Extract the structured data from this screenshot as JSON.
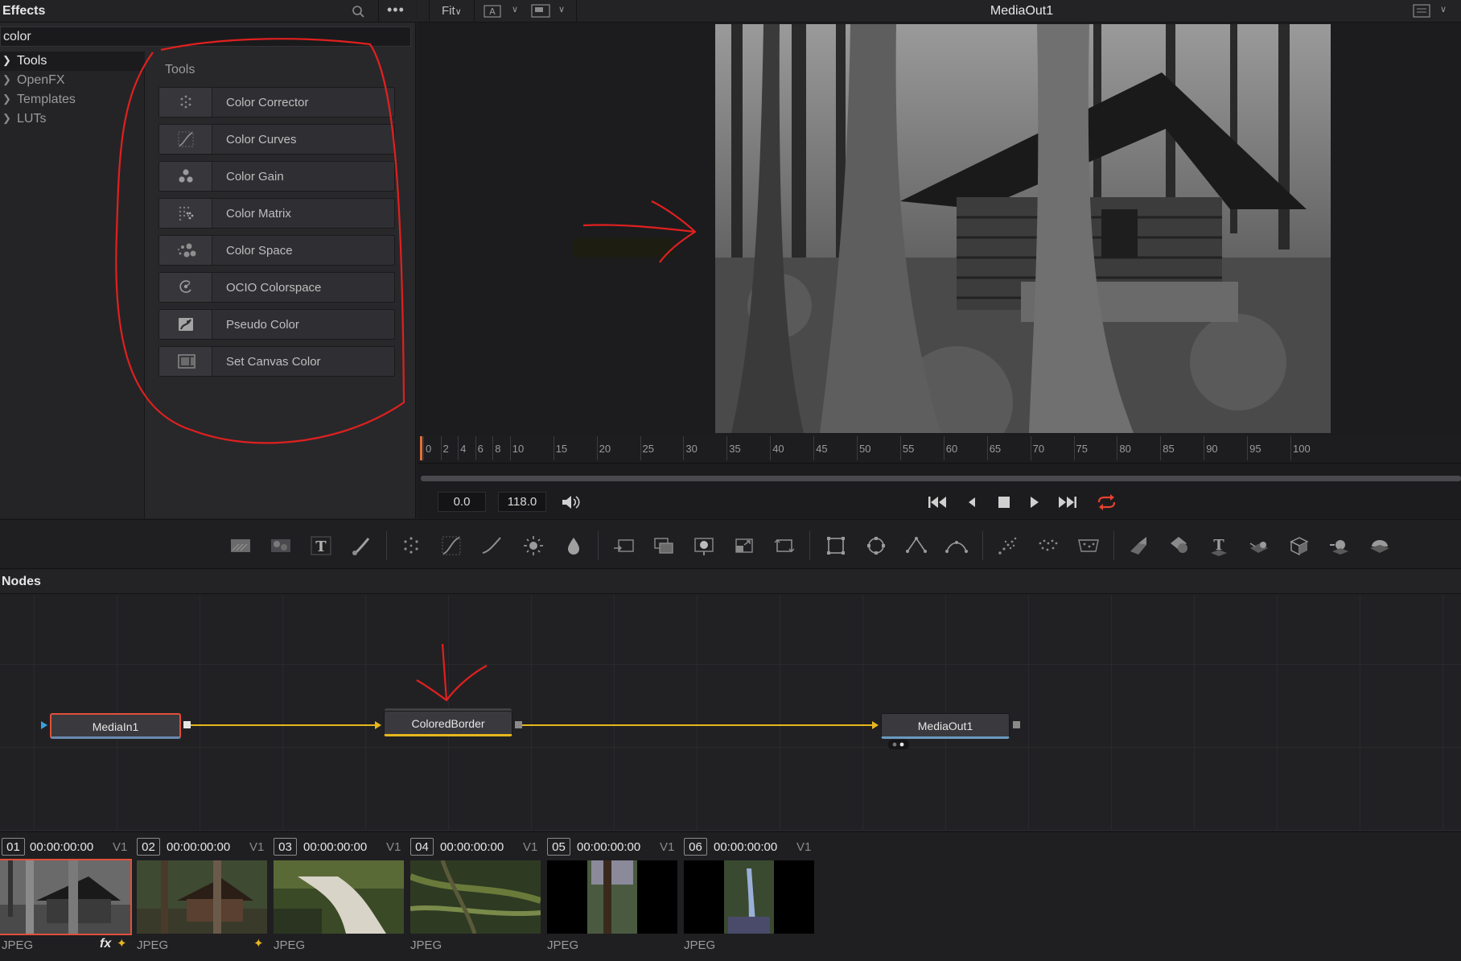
{
  "effects": {
    "title": "Effects",
    "search_value": "color",
    "tree": [
      {
        "label": "Tools",
        "selected": true
      },
      {
        "label": "OpenFX",
        "selected": false
      },
      {
        "label": "Templates",
        "selected": false
      },
      {
        "label": "LUTs",
        "selected": false
      }
    ],
    "section_heading": "Tools",
    "tools": [
      {
        "label": "Color Corrector",
        "icon": "color-corrector-icon"
      },
      {
        "label": "Color Curves",
        "icon": "color-curves-icon"
      },
      {
        "label": "Color Gain",
        "icon": "color-gain-icon"
      },
      {
        "label": "Color Matrix",
        "icon": "color-matrix-icon"
      },
      {
        "label": "Color Space",
        "icon": "color-space-icon"
      },
      {
        "label": "OCIO Colorspace",
        "icon": "ocio-colorspace-icon"
      },
      {
        "label": "Pseudo Color",
        "icon": "pseudo-color-icon"
      },
      {
        "label": "Set Canvas Color",
        "icon": "set-canvas-color-icon"
      }
    ]
  },
  "viewer": {
    "fit_label": "Fit",
    "title": "MediaOut1",
    "ruler_ticks": [
      "0",
      "2",
      "4",
      "6",
      "8",
      "10",
      "15",
      "20",
      "25",
      "30",
      "35",
      "40",
      "45",
      "50",
      "55",
      "60",
      "65",
      "70",
      "75",
      "80",
      "85",
      "90",
      "95",
      "100"
    ],
    "current_time": "0.0",
    "end_time": "118.0"
  },
  "nodes": {
    "title": "Nodes",
    "items": [
      {
        "label": "MediaIn1"
      },
      {
        "label": "ColoredBorder"
      },
      {
        "label": "MediaOut1"
      }
    ]
  },
  "clips": [
    {
      "num": "01",
      "timecode": "00:00:00:00",
      "track": "V1",
      "format": "JPEG",
      "fx": true,
      "selected": true
    },
    {
      "num": "02",
      "timecode": "00:00:00:00",
      "track": "V1",
      "format": "JPEG",
      "fx": false,
      "selected": false
    },
    {
      "num": "03",
      "timecode": "00:00:00:00",
      "track": "V1",
      "format": "JPEG",
      "fx": false,
      "selected": false
    },
    {
      "num": "04",
      "timecode": "00:00:00:00",
      "track": "V1",
      "format": "JPEG",
      "fx": false,
      "selected": false
    },
    {
      "num": "05",
      "timecode": "00:00:00:00",
      "track": "V1",
      "format": "JPEG",
      "fx": false,
      "selected": false
    },
    {
      "num": "06",
      "timecode": "00:00:00:00",
      "track": "V1",
      "format": "JPEG",
      "fx": false,
      "selected": false
    }
  ],
  "fx_label": "fx",
  "colors": {
    "connection": "#e8b71d",
    "annotation": "#e0201e",
    "selected_border": "#e0503a",
    "loop_active": "#e8432e"
  }
}
